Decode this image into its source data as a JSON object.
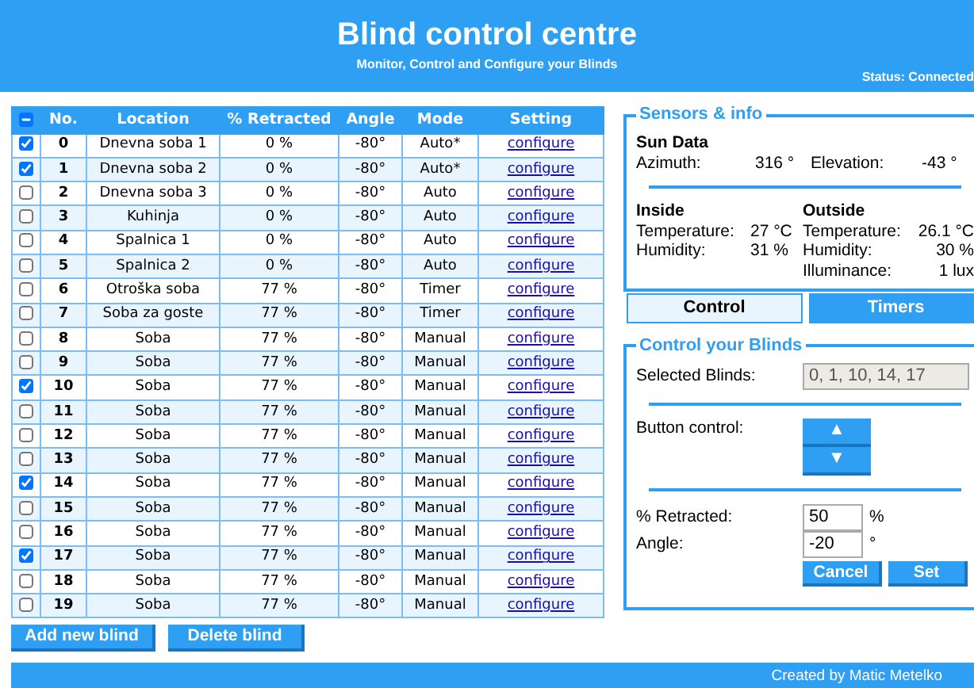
{
  "header": {
    "title": "Blind control centre",
    "subtitle": "Monitor, Control and Configure your Blinds",
    "status": "Status: Connected"
  },
  "table": {
    "select_all": {
      "indeterminate": true
    },
    "columns": [
      "No.",
      "Location",
      "% Retracted",
      "Angle",
      "Mode",
      "Setting"
    ],
    "rows": [
      {
        "checked": true,
        "no": "0",
        "location": "Dnevna soba 1",
        "retracted": "0 %",
        "angle": "-80°",
        "mode": "Auto*",
        "setting": "configure"
      },
      {
        "checked": true,
        "no": "1",
        "location": "Dnevna soba 2",
        "retracted": "0 %",
        "angle": "-80°",
        "mode": "Auto*",
        "setting": "configure"
      },
      {
        "checked": false,
        "no": "2",
        "location": "Dnevna soba 3",
        "retracted": "0 %",
        "angle": "-80°",
        "mode": "Auto",
        "setting": "configure"
      },
      {
        "checked": false,
        "no": "3",
        "location": "Kuhinja",
        "retracted": "0 %",
        "angle": "-80°",
        "mode": "Auto",
        "setting": "configure"
      },
      {
        "checked": false,
        "no": "4",
        "location": "Spalnica 1",
        "retracted": "0 %",
        "angle": "-80°",
        "mode": "Auto",
        "setting": "configure"
      },
      {
        "checked": false,
        "no": "5",
        "location": "Spalnica 2",
        "retracted": "0 %",
        "angle": "-80°",
        "mode": "Auto",
        "setting": "configure"
      },
      {
        "checked": false,
        "no": "6",
        "location": "Otroška soba",
        "retracted": "77 %",
        "angle": "-80°",
        "mode": "Timer",
        "setting": "configure"
      },
      {
        "checked": false,
        "no": "7",
        "location": "Soba za goste",
        "retracted": "77 %",
        "angle": "-80°",
        "mode": "Timer",
        "setting": "configure"
      },
      {
        "checked": false,
        "no": "8",
        "location": "Soba",
        "retracted": "77 %",
        "angle": "-80°",
        "mode": "Manual",
        "setting": "configure"
      },
      {
        "checked": false,
        "no": "9",
        "location": "Soba",
        "retracted": "77 %",
        "angle": "-80°",
        "mode": "Manual",
        "setting": "configure"
      },
      {
        "checked": true,
        "no": "10",
        "location": "Soba",
        "retracted": "77 %",
        "angle": "-80°",
        "mode": "Manual",
        "setting": "configure"
      },
      {
        "checked": false,
        "no": "11",
        "location": "Soba",
        "retracted": "77 %",
        "angle": "-80°",
        "mode": "Manual",
        "setting": "configure"
      },
      {
        "checked": false,
        "no": "12",
        "location": "Soba",
        "retracted": "77 %",
        "angle": "-80°",
        "mode": "Manual",
        "setting": "configure"
      },
      {
        "checked": false,
        "no": "13",
        "location": "Soba",
        "retracted": "77 %",
        "angle": "-80°",
        "mode": "Manual",
        "setting": "configure"
      },
      {
        "checked": true,
        "no": "14",
        "location": "Soba",
        "retracted": "77 %",
        "angle": "-80°",
        "mode": "Manual",
        "setting": "configure"
      },
      {
        "checked": false,
        "no": "15",
        "location": "Soba",
        "retracted": "77 %",
        "angle": "-80°",
        "mode": "Manual",
        "setting": "configure"
      },
      {
        "checked": false,
        "no": "16",
        "location": "Soba",
        "retracted": "77 %",
        "angle": "-80°",
        "mode": "Manual",
        "setting": "configure"
      },
      {
        "checked": true,
        "no": "17",
        "location": "Soba",
        "retracted": "77 %",
        "angle": "-80°",
        "mode": "Manual",
        "setting": "configure"
      },
      {
        "checked": false,
        "no": "18",
        "location": "Soba",
        "retracted": "77 %",
        "angle": "-80°",
        "mode": "Manual",
        "setting": "configure"
      },
      {
        "checked": false,
        "no": "19",
        "location": "Soba",
        "retracted": "77 %",
        "angle": "-80°",
        "mode": "Manual",
        "setting": "configure"
      }
    ]
  },
  "table_buttons": [
    "Add new blind",
    "Delete blind"
  ],
  "sensors": {
    "legend": "Sensors & info",
    "sun": {
      "heading": "Sun Data",
      "items": [
        {
          "label": "Azimuth:",
          "value": "316 °"
        },
        {
          "label": "Elevation:",
          "value": "-43 °"
        }
      ]
    },
    "groups": [
      {
        "heading": "Inside",
        "items": [
          {
            "label": "Temperature:",
            "value": "27 °C"
          },
          {
            "label": "Humidity:",
            "value": "31 %"
          }
        ]
      },
      {
        "heading": "Outside",
        "items": [
          {
            "label": "Temperature:",
            "value": "26.1 °C"
          },
          {
            "label": "Humidity:",
            "value": "30 %"
          },
          {
            "label": "Illuminance:",
            "value": "1 lux"
          }
        ]
      }
    ]
  },
  "tabs": [
    {
      "label": "Control",
      "selected": true
    },
    {
      "label": "Timers",
      "selected": false
    }
  ],
  "control": {
    "legend": "Control your Blinds",
    "selected_label": "Selected Blinds:",
    "selected_value": "0, 1, 10, 14, 17",
    "button_label": "Button control:",
    "up": "▲",
    "down": "▼",
    "fields": [
      {
        "label": "% Retracted:",
        "value": "50",
        "unit": "%"
      },
      {
        "label": "Angle:",
        "value": "-20",
        "unit": "°"
      }
    ],
    "buttons": [
      "Cancel",
      "Set"
    ]
  },
  "footer": "Created by Matic Metelko"
}
